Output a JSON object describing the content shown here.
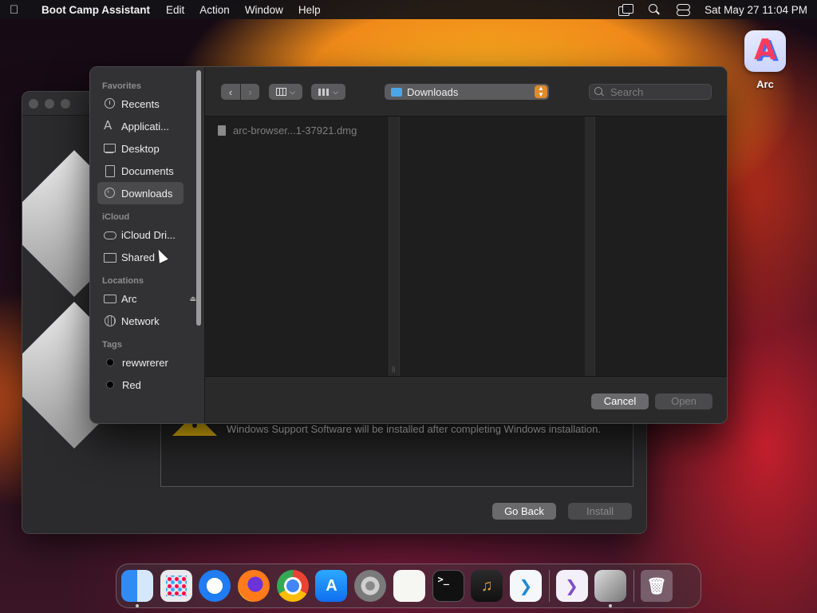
{
  "menubar": {
    "app_name": "Boot Camp Assistant",
    "menus": [
      "Edit",
      "Action",
      "Window",
      "Help"
    ],
    "clock": "Sat May 27  11:04 PM"
  },
  "desktop": {
    "icons": [
      {
        "label": "Arc",
        "icon": "arc-app-icon"
      }
    ]
  },
  "bootcamp_window": {
    "info_text": "Windows Support Software will be installed after completing Windows installation.",
    "go_back_label": "Go Back",
    "install_label": "Install",
    "install_enabled": false
  },
  "open_dialog": {
    "sidebar": {
      "sections": [
        {
          "title": "Favorites",
          "items": [
            {
              "label": "Recents",
              "icon": "clock-icon"
            },
            {
              "label": "Applicati...",
              "icon": "applications-icon"
            },
            {
              "label": "Desktop",
              "icon": "desktop-icon"
            },
            {
              "label": "Documents",
              "icon": "document-icon"
            },
            {
              "label": "Downloads",
              "icon": "downloads-icon",
              "selected": true
            }
          ]
        },
        {
          "title": "iCloud",
          "items": [
            {
              "label": "iCloud Dri...",
              "icon": "cloud-icon"
            },
            {
              "label": "Shared",
              "icon": "shared-folder-icon"
            }
          ]
        },
        {
          "title": "Locations",
          "items": [
            {
              "label": "Arc",
              "icon": "drive-icon",
              "eject": true
            },
            {
              "label": "Network",
              "icon": "globe-icon"
            }
          ]
        },
        {
          "title": "Tags",
          "items": [
            {
              "label": "rewwrerer",
              "color": "#000000"
            },
            {
              "label": "Red",
              "color": "#000000"
            }
          ]
        }
      ]
    },
    "toolbar": {
      "back_glyph": "‹",
      "forward_glyph": "›",
      "view_mode": "columns",
      "location": "Downloads",
      "search_placeholder": "Search"
    },
    "files": [
      {
        "name": "arc-browser...1-37921.dmg",
        "icon": "file-icon",
        "enabled": false
      }
    ],
    "cancel_label": "Cancel",
    "open_label": "Open",
    "open_enabled": false
  },
  "dock": {
    "apps": [
      {
        "name": "Finder",
        "icon": "finder-icon",
        "running": true
      },
      {
        "name": "Launchpad",
        "icon": "launchpad-icon"
      },
      {
        "name": "Safari",
        "icon": "safari-icon"
      },
      {
        "name": "Firefox",
        "icon": "firefox-icon"
      },
      {
        "name": "Chrome",
        "icon": "chrome-icon"
      },
      {
        "name": "App Store",
        "icon": "app-store-icon"
      },
      {
        "name": "System Settings",
        "icon": "settings-gear-icon"
      },
      {
        "name": "TextEdit",
        "icon": "textedit-icon"
      },
      {
        "name": "Terminal",
        "icon": "terminal-icon"
      },
      {
        "name": "GarageBand",
        "icon": "garageband-icon"
      },
      {
        "name": "Visual Studio Code",
        "icon": "vscode-icon"
      },
      {
        "name": "Visual Studio",
        "icon": "visual-studio-icon"
      },
      {
        "name": "Boot Camp Assistant",
        "icon": "bootcamp-icon",
        "running": true
      },
      {
        "name": "Trash",
        "icon": "trash-icon"
      }
    ],
    "terminal_glyph": ">_",
    "trash_glyph": "🗑"
  }
}
